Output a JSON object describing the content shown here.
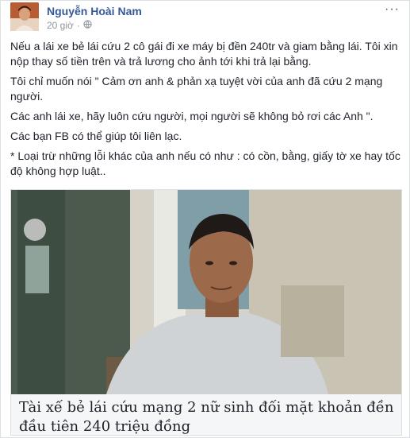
{
  "post": {
    "author": "Nguyễn Hoài Nam",
    "time": "20 giờ",
    "more_label": "···",
    "paragraphs": [
      "Nếu a lái xe bẻ lái cứu 2 cô gái đi xe máy bị đền 240tr và giam bằng lái. Tôi xin nộp thay số tiền trên và trả lương cho ảnh tới khi trả lại bằng.",
      "Tôi chỉ muốn nói \" Cảm ơn anh & phản xạ tuyệt vời của anh đã cứu 2 mạng người.",
      "Các anh lái xe, hãy luôn cứu người, mọi người sẽ không bỏ rơi các Anh \".",
      "Các bạn FB có thể giúp tôi liên lạc.",
      "* Loại trừ những lỗi khác của anh nếu có như : có cồn, bằng, giấy tờ xe hay tốc độ không hợp luật.."
    ]
  },
  "link": {
    "title": "Tài xế bẻ lái cứu mạng 2 nữ sinh đối mặt khoản đền đầu tiên 240 triệu đồng"
  },
  "colors": {
    "author": "#365899",
    "meta": "#90949c",
    "body_text": "#1d2129",
    "card_bg": "#f5f6f7"
  },
  "icons": {
    "privacy": "globe-icon",
    "menu": "more-horizontal-icon"
  }
}
